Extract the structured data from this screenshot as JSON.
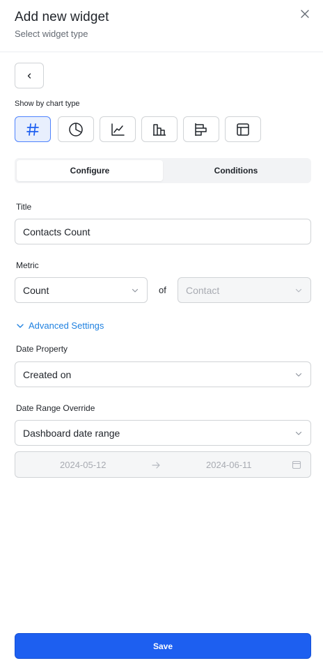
{
  "header": {
    "title": "Add new widget",
    "subtitle": "Select widget type",
    "close_icon": "close-icon"
  },
  "back_icon": "chevron-left-icon",
  "chart_type": {
    "label": "Show by chart type",
    "selected": "number",
    "options": [
      {
        "id": "number",
        "icon": "hash-icon"
      },
      {
        "id": "pie",
        "icon": "pie-chart-icon"
      },
      {
        "id": "line",
        "icon": "line-chart-icon"
      },
      {
        "id": "column",
        "icon": "column-chart-icon"
      },
      {
        "id": "bar",
        "icon": "bar-chart-icon"
      },
      {
        "id": "table",
        "icon": "table-icon"
      }
    ]
  },
  "tabs": [
    {
      "label": "Configure",
      "active": true
    },
    {
      "label": "Conditions",
      "active": false
    }
  ],
  "form": {
    "title_label": "Title",
    "title_value": "Contacts Count",
    "metric_label": "Metric",
    "metric_value": "Count",
    "of_label": "of",
    "object_value": "Contact",
    "advanced_label": "Advanced Settings",
    "date_property_label": "Date Property",
    "date_property_value": "Created on",
    "date_range_label": "Date Range Override",
    "date_range_value": "Dashboard date range",
    "range_start": "2024-05-12",
    "range_end": "2024-06-11"
  },
  "footer": {
    "save_label": "Save"
  },
  "colors": {
    "accent": "#1d5ff0",
    "link": "#1f81e0",
    "selected_bg": "#e8effd"
  }
}
